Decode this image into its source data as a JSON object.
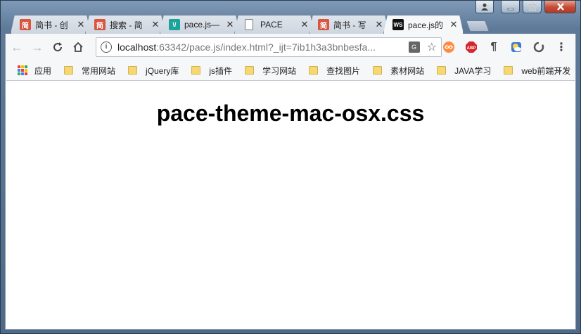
{
  "window": {
    "controls": [
      "user",
      "minimize",
      "maximize",
      "close"
    ]
  },
  "tabs": [
    {
      "label": "简书 - 创",
      "favicon": "jianshu-icon",
      "favicon_text": "简",
      "favicon_color": "#d9553f",
      "active": false
    },
    {
      "label": "搜索 - 简",
      "favicon": "jianshu-icon",
      "favicon_text": "简",
      "favicon_color": "#d9553f",
      "active": false
    },
    {
      "label": "pace.js—",
      "favicon": "pace-icon",
      "favicon_text": "\\/",
      "favicon_color": "#1ba39c",
      "active": false
    },
    {
      "label": "PACE",
      "favicon": "page-icon",
      "favicon_text": "",
      "favicon_color": "#ffffff",
      "active": false
    },
    {
      "label": "简书 - 写",
      "favicon": "jianshu-icon",
      "favicon_text": "简",
      "favicon_color": "#d9553f",
      "active": false
    },
    {
      "label": "pace.js的",
      "favicon": "webstorm-icon",
      "favicon_text": "WS",
      "favicon_color": "#111111",
      "active": true
    }
  ],
  "toolbar": {
    "url_host": "localhost",
    "url_rest": ":63342/pace.js/index.html?_ijt=7ib1h3a3bnbesfa...",
    "info_icon": "info-icon"
  },
  "extensions": [
    "infinity-icon",
    "adblock-icon",
    "paragraph-icon",
    "weather-icon",
    "circle-icon"
  ],
  "bookmarks": {
    "apps_label": "应用",
    "items": [
      "常用网站",
      "jQuery库",
      "js插件",
      "学习网站",
      "查找图片",
      "素材网站",
      "JAVA学习",
      "web前端开发"
    ],
    "more": "»"
  },
  "page": {
    "heading": "pace-theme-mac-osx.css"
  }
}
